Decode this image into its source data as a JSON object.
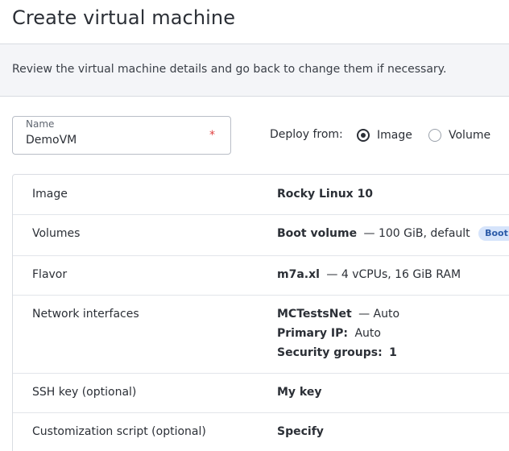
{
  "page": {
    "title": "Create virtual machine",
    "description": "Review the virtual machine details and go back to change them if necessary."
  },
  "form": {
    "name_label": "Name",
    "name_value": "DemoVM",
    "required_mark": "*",
    "deploy_from_label": "Deploy from:",
    "deploy_options": [
      "Image",
      "Volume"
    ],
    "deploy_selected": "Image"
  },
  "summary": {
    "image": {
      "label": "Image",
      "value": "Rocky Linux 10"
    },
    "volumes": {
      "label": "Volumes",
      "value": "Boot volume",
      "detail": "— 100 GiB, default",
      "badge": "Boot"
    },
    "flavor": {
      "label": "Flavor",
      "value": "m7a.xl",
      "detail": "— 4 vCPUs, 16 GiB RAM"
    },
    "network": {
      "label": "Network interfaces",
      "network_name": "MCTestsNet",
      "network_detail": "— Auto",
      "primary_ip_label": "Primary IP:",
      "primary_ip_value": "Auto",
      "security_groups_label": "Security groups:",
      "security_groups_value": "1"
    },
    "ssh": {
      "label": "SSH key (optional)",
      "value": "My key"
    },
    "script": {
      "label": "Customization script (optional)",
      "value": "Specify"
    }
  },
  "colors": {
    "accent_badge_bg": "#d6e4fb",
    "accent_badge_text": "#2b5aa8",
    "required": "#e04040"
  }
}
